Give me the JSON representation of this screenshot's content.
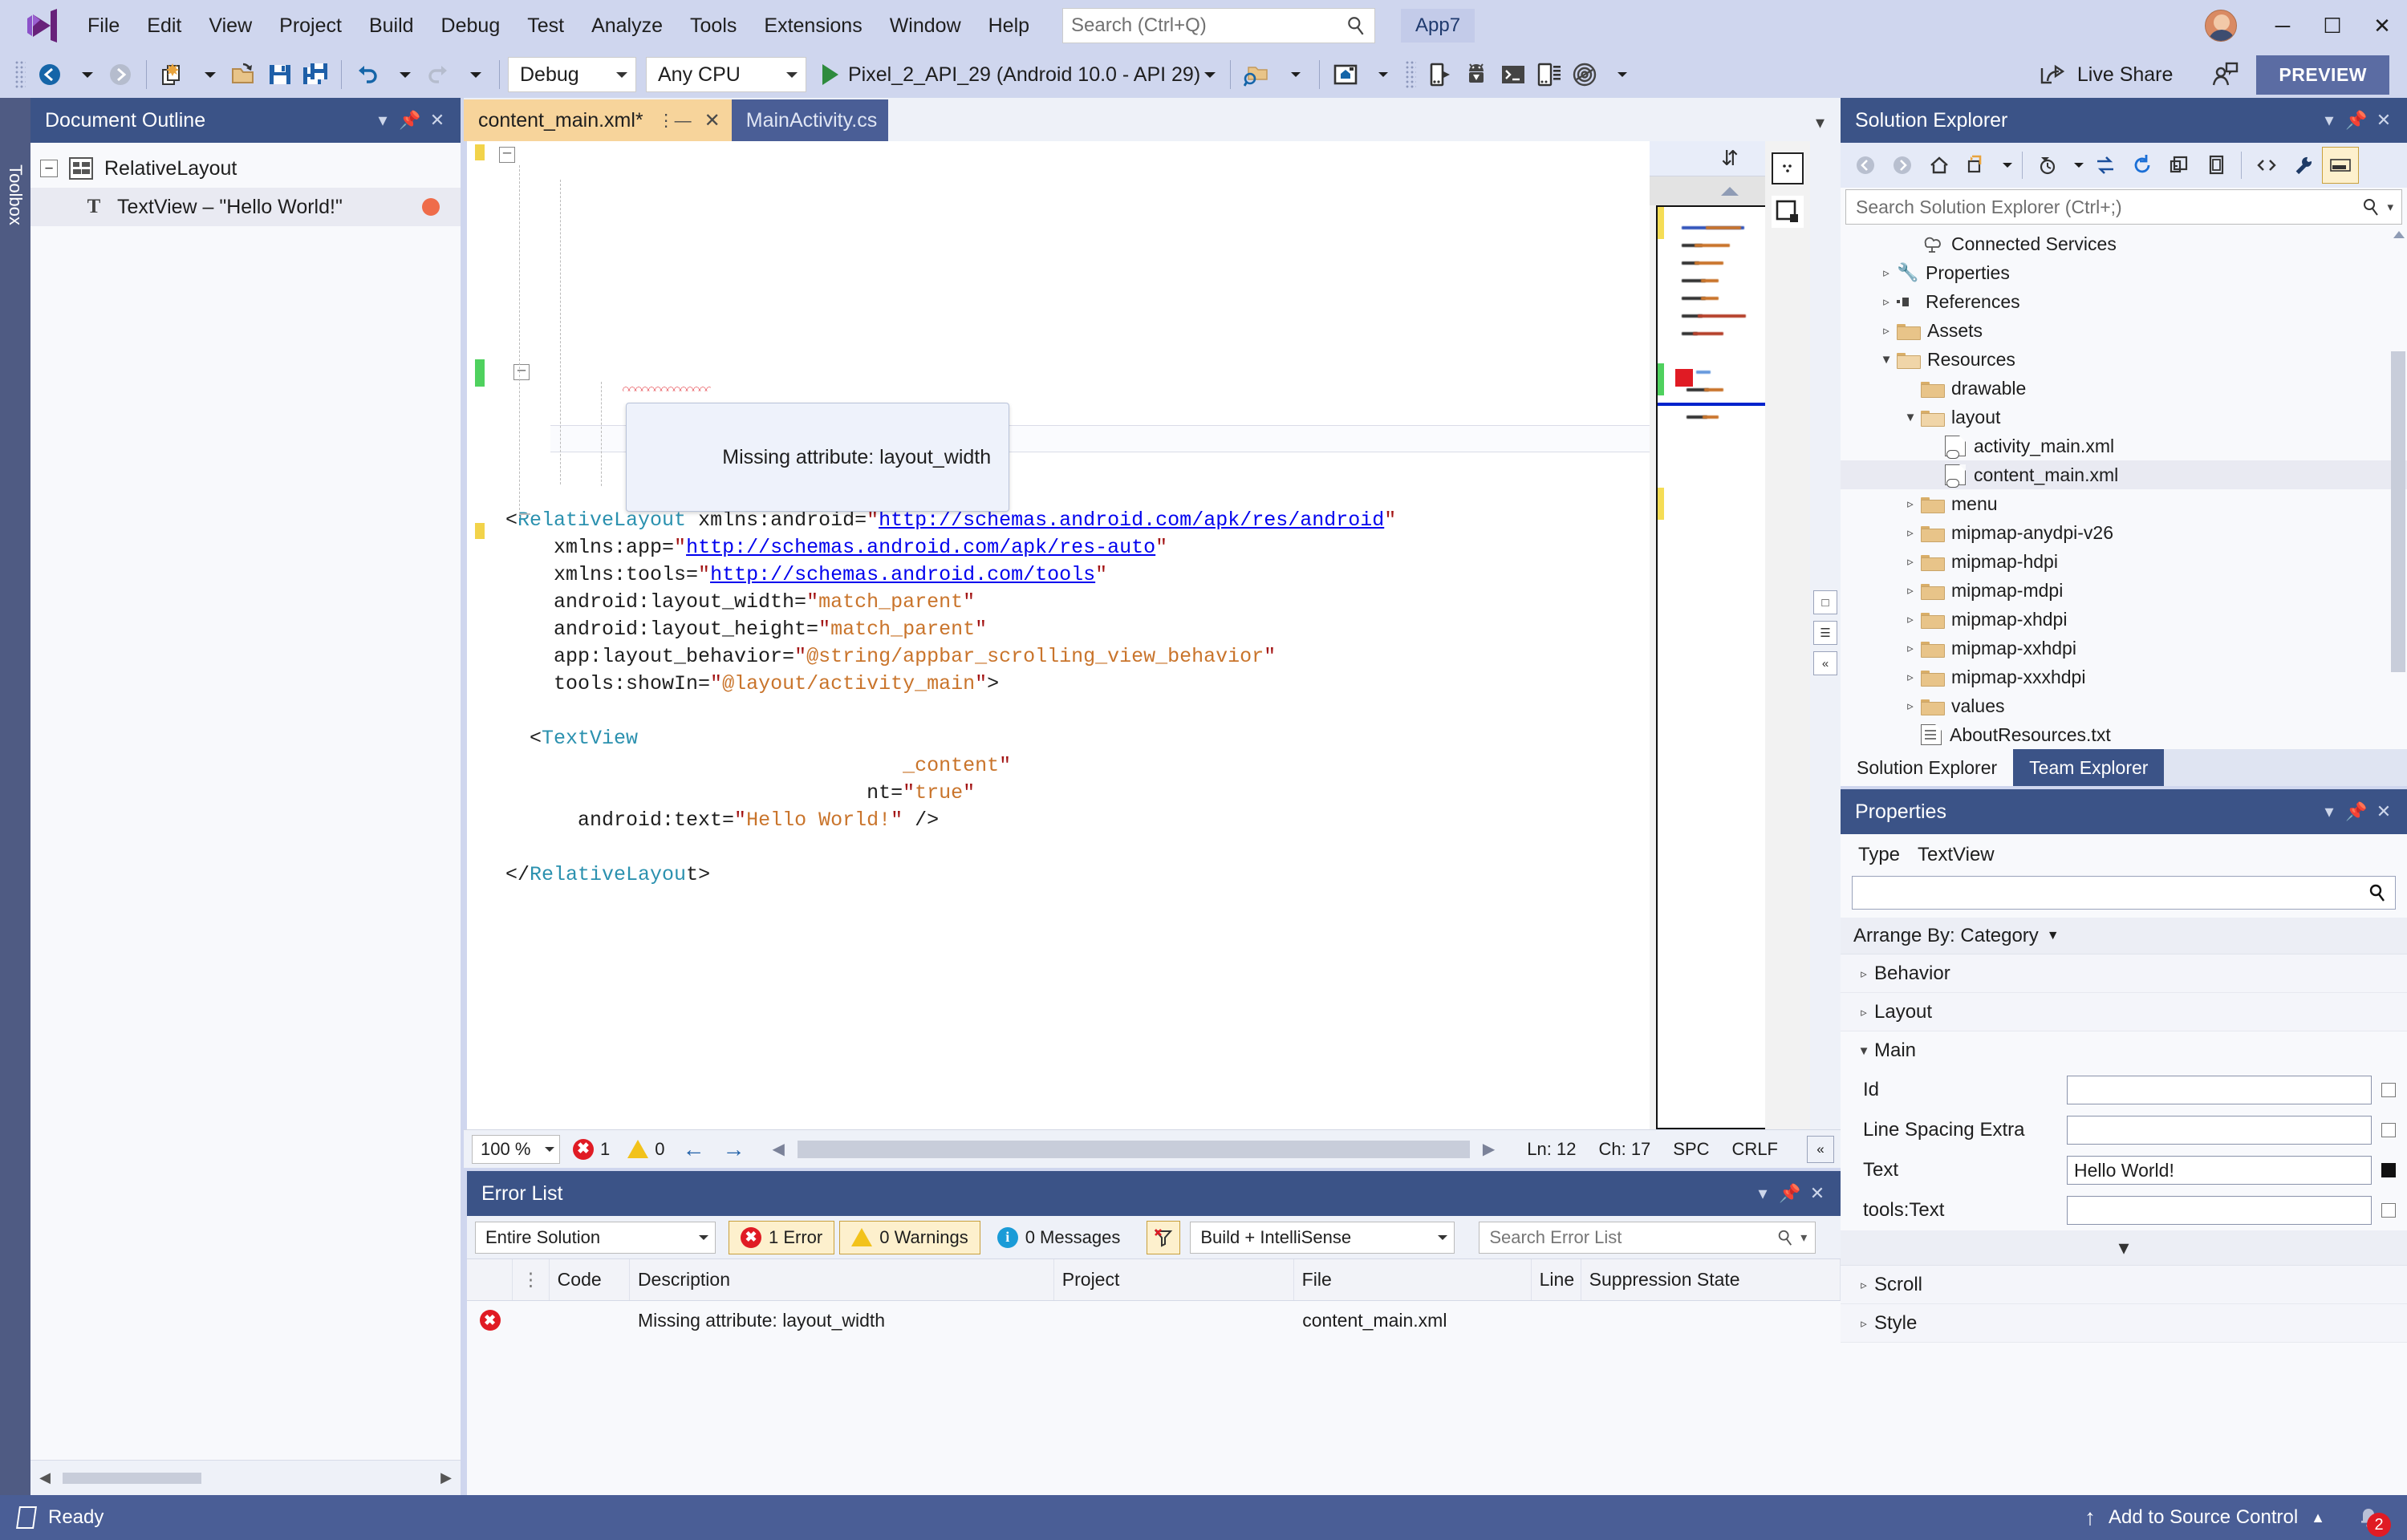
{
  "titlebar": {
    "logo_icon": "visual-studio-logo",
    "menus": [
      "File",
      "Edit",
      "View",
      "Project",
      "Build",
      "Debug",
      "Test",
      "Analyze",
      "Tools",
      "Extensions",
      "Window",
      "Help"
    ],
    "search_placeholder": "Search (Ctrl+Q)",
    "search_icon": "search-icon",
    "app_tag": "App7",
    "avatar_icon": "user-avatar",
    "minimize": "─",
    "maximize": "☐",
    "close": "✕"
  },
  "toolbar": {
    "back_icon": "navigate-back-icon",
    "forward_icon": "navigate-forward-icon",
    "new_item_icon": "new-file-icon",
    "open_icon": "open-folder-icon",
    "save_icon": "save-icon",
    "save_all_icon": "save-all-icon",
    "undo_icon": "undo-icon",
    "redo_icon": "redo-icon",
    "config_label": "Debug",
    "platform_label": "Any CPU",
    "run_target_label": "Pixel_2_API_29 (Android 10.0 - API 29)",
    "run_icon": "play-icon",
    "device_manager_icon": "android-device-manager-icon",
    "designer_icon": "android-designer-icon",
    "deploy_icon": "deploy-icon",
    "sdk_manager_icon": "android-sdk-icon",
    "adb_shell_icon": "adb-console-icon",
    "device_log_icon": "device-log-icon",
    "profiler_icon": "profiler-icon",
    "live_share_label": "Live Share",
    "live_share_icon": "live-share-icon",
    "invite_icon": "invite-person-icon",
    "preview_label": "PREVIEW"
  },
  "toolbox_rail": {
    "label": "Toolbox"
  },
  "document_outline": {
    "title": "Document Outline",
    "dropdown_icon": "chevron-down-icon",
    "pin_icon": "pin-icon",
    "close_icon": "close-icon",
    "items": [
      {
        "label": "RelativeLayout",
        "icon": "relative-layout-icon",
        "expander": "−",
        "selected": false,
        "error": false
      },
      {
        "label": "TextView –  \"Hello World!\"",
        "icon": "textview-icon",
        "expander": "",
        "selected": true,
        "error": true
      }
    ]
  },
  "editor": {
    "tabs": [
      {
        "label": "content_main.xml*",
        "active": true,
        "pin_icon": "pin-icon",
        "close_icon": "close-icon"
      },
      {
        "label": "MainActivity.cs",
        "active": false
      }
    ],
    "tab_overflow_icon": "chevron-down-icon",
    "code_lines": [
      [
        {
          "t": "punct",
          "v": "<"
        },
        {
          "t": "tag",
          "v": "RelativeLayout"
        },
        {
          "t": "attr",
          "v": " xmlns:android="
        },
        {
          "t": "str",
          "v": "\""
        },
        {
          "t": "url",
          "v": "http://schemas.android.com/apk/res/android"
        },
        {
          "t": "str",
          "v": "\""
        }
      ],
      [
        {
          "t": "attr",
          "v": "    xmlns:app="
        },
        {
          "t": "str",
          "v": "\""
        },
        {
          "t": "url",
          "v": "http://schemas.android.com/apk/res-auto"
        },
        {
          "t": "str",
          "v": "\""
        }
      ],
      [
        {
          "t": "attr",
          "v": "    xmlns:tools="
        },
        {
          "t": "str",
          "v": "\""
        },
        {
          "t": "url",
          "v": "http://schemas.android.com/tools"
        },
        {
          "t": "str",
          "v": "\""
        }
      ],
      [
        {
          "t": "attr",
          "v": "    android:layout_width="
        },
        {
          "t": "str",
          "v": "\""
        },
        {
          "t": "val",
          "v": "match_parent"
        },
        {
          "t": "str",
          "v": "\""
        }
      ],
      [
        {
          "t": "attr",
          "v": "    android:layout_height="
        },
        {
          "t": "str",
          "v": "\""
        },
        {
          "t": "val",
          "v": "match_parent"
        },
        {
          "t": "str",
          "v": "\""
        }
      ],
      [
        {
          "t": "attr",
          "v": "    app:layout_behavior="
        },
        {
          "t": "str",
          "v": "\""
        },
        {
          "t": "val",
          "v": "@string/appbar_scrolling_view_behavior"
        },
        {
          "t": "str",
          "v": "\""
        }
      ],
      [
        {
          "t": "attr",
          "v": "    tools:showIn="
        },
        {
          "t": "str",
          "v": "\""
        },
        {
          "t": "val",
          "v": "@layout/activity_main"
        },
        {
          "t": "str",
          "v": "\""
        },
        {
          "t": "punct",
          "v": ">"
        }
      ],
      [],
      [
        {
          "t": "punct",
          "v": "  <"
        },
        {
          "t": "tag",
          "v": "TextView"
        }
      ],
      [
        {
          "t": "attr",
          "v": "                                 "
        },
        {
          "t": "val",
          "v": "_content"
        },
        {
          "t": "str",
          "v": "\""
        }
      ],
      [
        {
          "t": "attr",
          "v": "                              nt="
        },
        {
          "t": "str",
          "v": "\""
        },
        {
          "t": "val",
          "v": "true"
        },
        {
          "t": "str",
          "v": "\""
        }
      ],
      [
        {
          "t": "attr",
          "v": "      android:text="
        },
        {
          "t": "str",
          "v": "\""
        },
        {
          "t": "val",
          "v": "Hello World!"
        },
        {
          "t": "str",
          "v": "\""
        },
        {
          "t": "punct",
          "v": " />"
        }
      ],
      [],
      [
        {
          "t": "punct",
          "v": "</"
        },
        {
          "t": "tag",
          "v": "RelativeLayou"
        },
        {
          "t": "punct",
          "v": "t>"
        }
      ]
    ],
    "tooltip_text": "Missing attribute: layout_width",
    "minimap_splitter_icon": "split-vertical-icon",
    "minimap_scrollup_icon": "scroll-up-icon",
    "minimap_preview_icon": "preview-code-icon",
    "minimap_device_icon": "device-preview-icon",
    "status": {
      "zoom": "100 %",
      "error_count": "1",
      "warning_count": "0",
      "prev_icon": "arrow-left-icon",
      "next_icon": "arrow-right-icon",
      "line": "Ln: 12",
      "col": "Ch: 17",
      "spaces": "SPC",
      "eol": "CRLF",
      "collapse_icon": "collapse-icon"
    },
    "split_icons": {
      "top": "split-view-icon",
      "mid": "split-horizontal-icon",
      "bottom": "collapse-panel-icon"
    }
  },
  "error_list": {
    "title": "Error List",
    "dropdown_icon": "chevron-down-icon",
    "pin_icon": "pin-icon",
    "close_icon": "close-icon",
    "scope_label": "Entire Solution",
    "errors_label": "1 Error",
    "warnings_label": "0 Warnings",
    "messages_label": "0 Messages",
    "filter_icon": "clear-filter-icon",
    "source_label": "Build + IntelliSense",
    "search_placeholder": "Search Error List",
    "search_icon": "search-icon",
    "columns": [
      "",
      "",
      "Code",
      "Description",
      "Project",
      "File",
      "Line",
      "Suppression State"
    ],
    "rows": [
      {
        "severity_icon": "error-icon",
        "code": "",
        "description": "Missing attribute: layout_width",
        "project": "",
        "file": "content_main.xml",
        "line": "",
        "suppression": ""
      }
    ]
  },
  "solution_explorer": {
    "title": "Solution Explorer",
    "dropdown_icon": "chevron-down-icon",
    "pin_icon": "pin-icon",
    "close_icon": "close-icon",
    "toolbar_icons": [
      "back-icon",
      "forward-icon",
      "home-icon",
      "sync-with-active-document-icon",
      "chevron-down-icon",
      "pending-changes-icon",
      "switch-views-icon",
      "refresh-icon",
      "collapse-all-icon",
      "show-all-files-icon",
      "view-code-icon",
      "properties-icon",
      "preview-selected-items-icon"
    ],
    "search_placeholder": "Search Solution Explorer (Ctrl+;)",
    "search_icon": "search-icon",
    "tree": [
      {
        "label": "Connected Services",
        "icon": "connected-services-icon",
        "indent": 2,
        "twisty": "",
        "selected": false
      },
      {
        "label": "Properties",
        "icon": "wrench-icon",
        "indent": 1,
        "twisty": "▹",
        "selected": false
      },
      {
        "label": "References",
        "icon": "references-icon",
        "indent": 1,
        "twisty": "▹",
        "selected": false
      },
      {
        "label": "Assets",
        "icon": "folder-icon",
        "indent": 1,
        "twisty": "▹",
        "selected": false
      },
      {
        "label": "Resources",
        "icon": "folder-open-icon",
        "indent": 1,
        "twisty": "▼",
        "selected": false
      },
      {
        "label": "drawable",
        "icon": "folder-icon",
        "indent": 2,
        "twisty": "",
        "selected": false
      },
      {
        "label": "layout",
        "icon": "folder-open-icon",
        "indent": 2,
        "twisty": "▼",
        "selected": false
      },
      {
        "label": "activity_main.xml",
        "icon": "xml-file-icon",
        "indent": 3,
        "twisty": "",
        "selected": false
      },
      {
        "label": "content_main.xml",
        "icon": "xml-file-icon",
        "indent": 3,
        "twisty": "",
        "selected": true
      },
      {
        "label": "menu",
        "icon": "folder-icon",
        "indent": 2,
        "twisty": "▹",
        "selected": false
      },
      {
        "label": "mipmap-anydpi-v26",
        "icon": "folder-icon",
        "indent": 2,
        "twisty": "▹",
        "selected": false
      },
      {
        "label": "mipmap-hdpi",
        "icon": "folder-icon",
        "indent": 2,
        "twisty": "▹",
        "selected": false
      },
      {
        "label": "mipmap-mdpi",
        "icon": "folder-icon",
        "indent": 2,
        "twisty": "▹",
        "selected": false
      },
      {
        "label": "mipmap-xhdpi",
        "icon": "folder-icon",
        "indent": 2,
        "twisty": "▹",
        "selected": false
      },
      {
        "label": "mipmap-xxhdpi",
        "icon": "folder-icon",
        "indent": 2,
        "twisty": "▹",
        "selected": false
      },
      {
        "label": "mipmap-xxxhdpi",
        "icon": "folder-icon",
        "indent": 2,
        "twisty": "▹",
        "selected": false
      },
      {
        "label": "values",
        "icon": "folder-icon",
        "indent": 2,
        "twisty": "▹",
        "selected": false
      },
      {
        "label": "AboutResources.txt",
        "icon": "text-file-icon",
        "indent": 2,
        "twisty": "",
        "selected": false
      }
    ],
    "tabs": [
      {
        "label": "Solution Explorer",
        "active": true
      },
      {
        "label": "Team Explorer",
        "active": false
      }
    ]
  },
  "properties": {
    "title": "Properties",
    "dropdown_icon": "chevron-down-icon",
    "pin_icon": "pin-icon",
    "close_icon": "close-icon",
    "type_key": "Type",
    "type_value": "TextView",
    "search_value": "",
    "search_icon": "search-icon",
    "arrange_label": "Arrange By: Category",
    "arrange_caret_icon": "chevron-down-icon",
    "categories": [
      {
        "label": "Behavior",
        "twisty": "▹",
        "expanded": false
      },
      {
        "label": "Layout",
        "twisty": "▹",
        "expanded": false
      },
      {
        "label": "Main",
        "twisty": "▼",
        "expanded": true
      }
    ],
    "main_rows": [
      {
        "label": "Id",
        "value": "",
        "marker": "empty"
      },
      {
        "label": "Line Spacing Extra",
        "value": "",
        "marker": "empty"
      },
      {
        "label": "Text",
        "value": "Hello World!",
        "marker": "filled"
      },
      {
        "label": "tools:Text",
        "value": "",
        "marker": "empty"
      }
    ],
    "more_icon": "chevron-down-icon",
    "trailing_categories": [
      {
        "label": "Scroll",
        "twisty": "▹"
      },
      {
        "label": "Style",
        "twisty": "▹"
      }
    ]
  },
  "statusbar": {
    "status_icon": "ready-icon",
    "status_text": "Ready",
    "source_control_icon": "upload-arrow-icon",
    "source_control_label": "Add to Source Control",
    "source_control_caret": "▲",
    "notification_icon": "bell-icon",
    "notification_count": "2"
  },
  "colors": {
    "title_bg": "#cfd6ee",
    "panel_header_bg": "#3b5387",
    "status_bar_bg": "#4a5e96",
    "active_tab_bg": "#f7d49b",
    "inactive_tab_bg": "#4a5e96",
    "error_red": "#e01b24",
    "warning_yellow": "#f2c21b",
    "accent_blue": "#2060a8",
    "link_blue": "#0000ee",
    "string_red": "#a31515",
    "value_orange": "#c9742b",
    "tag_teal": "#2b91af"
  }
}
